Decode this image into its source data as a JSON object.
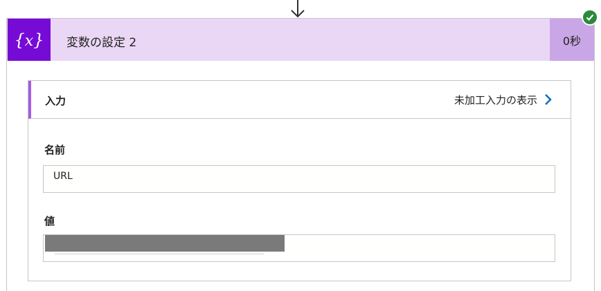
{
  "flow_arrow": {
    "icon": "arrow-down-icon"
  },
  "action": {
    "icon": "variable-icon",
    "icon_text": "{x}",
    "title": "変数の設定 2",
    "duration": "0秒",
    "status_icon": "check-circle-icon",
    "status_color": "#2a8a39",
    "header_color": "#ead7f5",
    "icon_bg_color": "#770bd6"
  },
  "inputs": {
    "label": "入力",
    "raw_link": "未加工入力の表示",
    "raw_link_icon": "chevron-right-icon",
    "name": {
      "label": "名前",
      "value": "URL"
    },
    "value": {
      "label": "値",
      "value": ""
    }
  }
}
